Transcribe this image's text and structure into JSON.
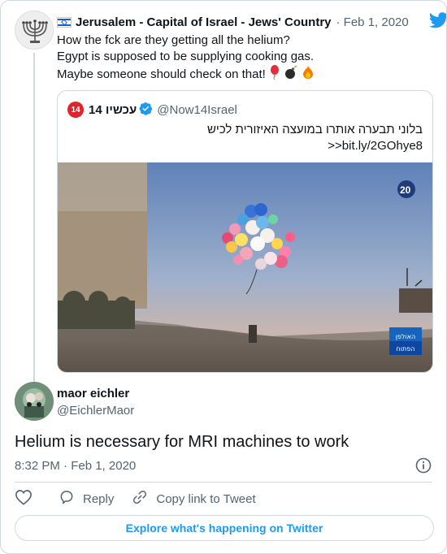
{
  "parent_tweet": {
    "author_name": "Jerusalem - Capital of Israel - Jews' Country",
    "date": "· Feb 1, 2020",
    "lines": [
      "How the fck are they getting all the helium?",
      "Egypt is supposed to be supplying cooking gas.",
      "Maybe someone should check on that!"
    ],
    "emojis": [
      "balloon",
      "bomb",
      "fire"
    ],
    "icons": {
      "flag": "israel-flag-icon",
      "logo": "twitter-bird-icon"
    }
  },
  "quoted_tweet": {
    "badge": "14",
    "author_name": "עכשיו 14",
    "handle": "@Now14Israel",
    "text": "בלוני תבערה אותרו במועצה האיזורית לכיש",
    "link": ">>bit.ly/2GOhye8",
    "media_logos": [
      "20",
      "האולפן הפתוח"
    ]
  },
  "main_tweet": {
    "author_name": "maor eichler",
    "handle": "@EichlerMaor",
    "text": "Helium is necessary for MRI machines to work",
    "timestamp": "8:32 PM · Feb 1, 2020"
  },
  "actions": {
    "reply_label": "Reply",
    "copy_label": "Copy link to Tweet"
  },
  "explore_label": "Explore what's happening on Twitter",
  "colors": {
    "accent": "#1d9bf0",
    "muted": "#536471",
    "border": "#cfd9de",
    "heart": "#536471"
  }
}
